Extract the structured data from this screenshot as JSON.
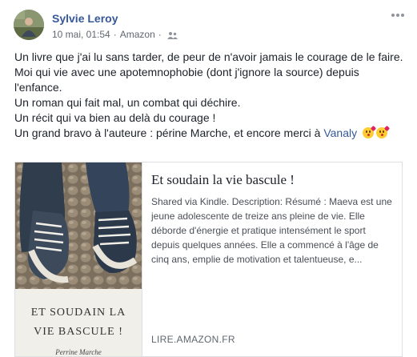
{
  "post": {
    "author": "Sylvie Leroy",
    "date": "10 mai, 01:54",
    "separator": "·",
    "source": "Amazon",
    "audience_icon": "friends-icon",
    "more_icon": "more-options-icon",
    "text": {
      "p1": "Un livre que j'ai lu sans tarder, de peur de n'avoir jamais le courage de le faire.",
      "p2": "Moi qui vie avec une apotemnophobie (dont j'ignore la source) depuis l'enfance.",
      "p3": "Un roman qui fait mal, un combat qui déchire.",
      "p4": "Un récit qui va bien au delà du courage !",
      "p5_prefix": "Un grand bravo à l'auteure : périne Marche, et encore merci à ",
      "mention": "Vanaly",
      "emoji": "kissing-face-emoji"
    }
  },
  "link": {
    "title": "Et soudain la vie bascule !",
    "description": "Shared via Kindle. Description: Résumé : Maeva est une jeune adolescente de treize ans pleine de vie. Elle déborde d'énergie et pratique intensément le sport depuis quelques années. Elle a commencé à l'âge de cinq ans, emplie de motivation et talentueuse, e...",
    "domain": "LIRE.AMAZON.FR",
    "cover": {
      "title_line1": "ET SOUDAIN LA",
      "title_line2": "VIE BASCULE !",
      "author": "Perrine Marche"
    }
  },
  "colors": {
    "link_blue": "#365899",
    "text": "#1d2129",
    "meta_gray": "#616770",
    "border": "#dddfe2"
  }
}
